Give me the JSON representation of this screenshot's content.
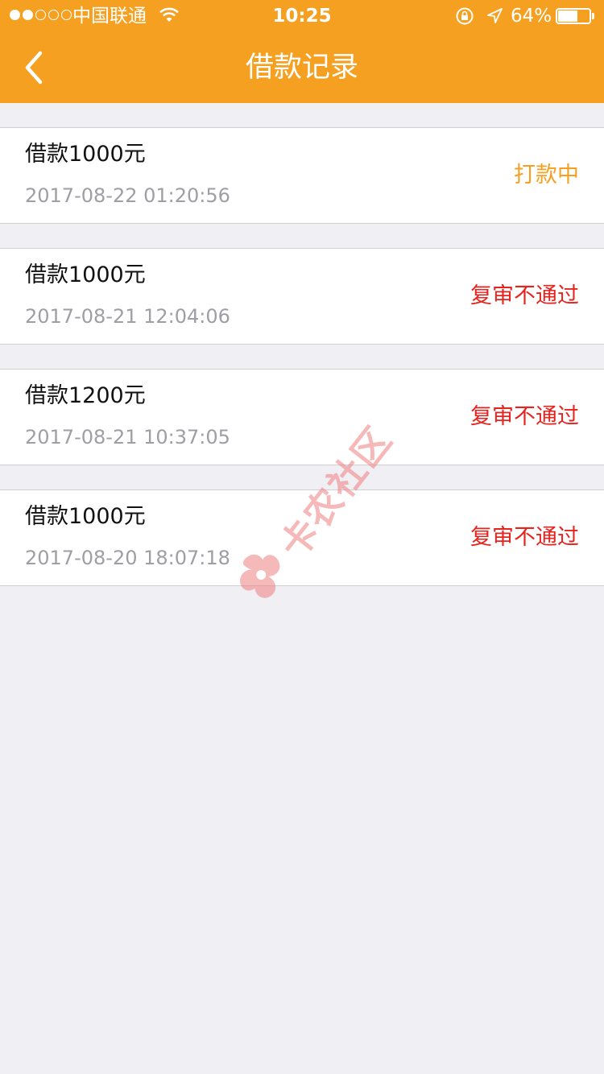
{
  "status_bar": {
    "carrier": "中国联通",
    "time": "10:25",
    "battery_percent_label": "64%",
    "battery_level": 0.64,
    "signal_bars_filled": 2,
    "signal_bars_total": 5,
    "icons": [
      "wifi-icon",
      "rotation-lock-icon",
      "location-arrow-icon",
      "battery-icon"
    ]
  },
  "nav": {
    "title": "借款记录",
    "back_icon": "chevron-left-icon"
  },
  "colors": {
    "brand_orange": "#f5a020",
    "status_processing": "#f5a020",
    "status_rejected": "#e8221c",
    "background": "#efeff4"
  },
  "records": [
    {
      "title": "借款1000元",
      "time": "2017-08-22 01:20:56",
      "status": "打款中",
      "status_color": "#f5a020"
    },
    {
      "title": "借款1000元",
      "time": "2017-08-21 12:04:06",
      "status": "复审不通过",
      "status_color": "#e8221c"
    },
    {
      "title": "借款1200元",
      "time": "2017-08-21 10:37:05",
      "status": "复审不通过",
      "status_color": "#e8221c"
    },
    {
      "title": "借款1000元",
      "time": "2017-08-20 18:07:18",
      "status": "复审不通过",
      "status_color": "#e8221c"
    }
  ],
  "watermark": {
    "text": "卡农社区"
  }
}
